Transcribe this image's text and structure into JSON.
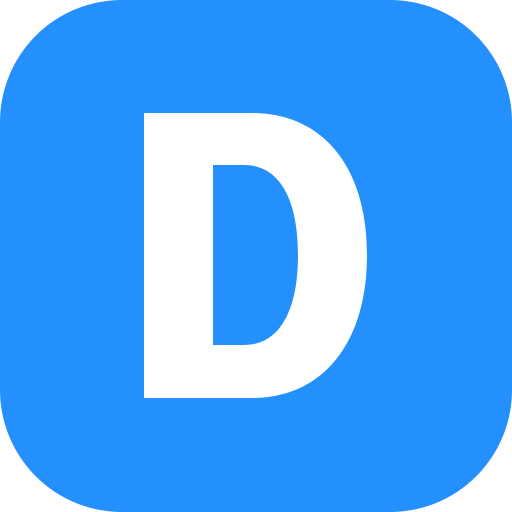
{
  "icon": {
    "name": "letter-d-app-icon",
    "letter": "D",
    "background_color": "#2490FE",
    "letter_color": "#FFFFFF"
  }
}
